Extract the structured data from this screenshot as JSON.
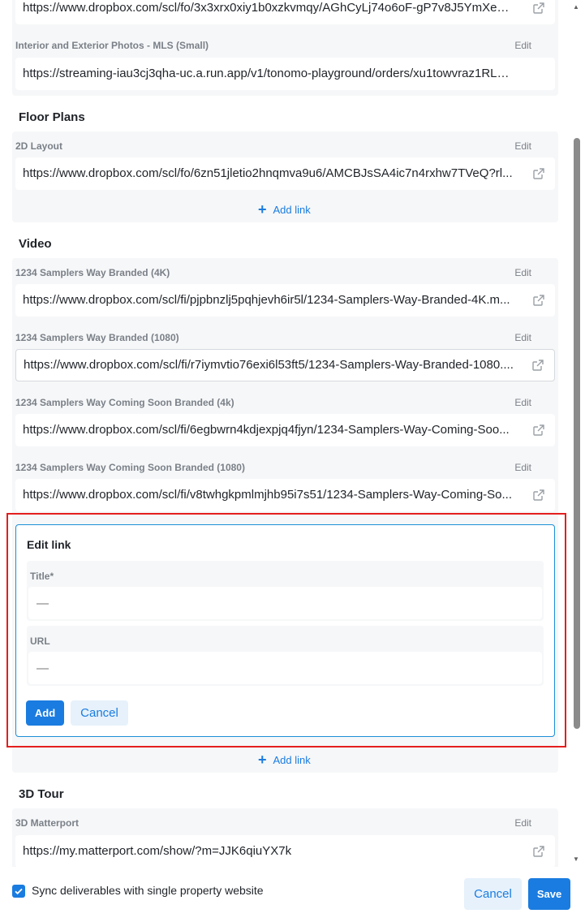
{
  "top_partial": {
    "url": "https://www.dropbox.com/scl/fo/3x3xrx0xiy1b0xzkvmqy/AGhCyLj74o6oF-gP7v8J5YmXey-pl..."
  },
  "sections": {
    "photos": {
      "items": [
        {
          "label": "Interior and Exterior Photos - MLS (Small)",
          "edit": "Edit",
          "url": "https://streaming-iau3cj3qha-uc.a.run.app/v1/tonomo-playground/orders/xu1towvraz1RLN..."
        }
      ]
    },
    "floor_plans": {
      "title": "Floor Plans",
      "items": [
        {
          "label": "2D Layout",
          "edit": "Edit",
          "url": "https://www.dropbox.com/scl/fo/6zn51jletio2hnqmva9u6/AMCBJsSA4ic7n4rxhw7TVeQ?rl..."
        }
      ],
      "add_link": "Add link"
    },
    "video": {
      "title": "Video",
      "items": [
        {
          "label": "1234 Samplers Way Branded (4K)",
          "edit": "Edit",
          "url": "https://www.dropbox.com/scl/fi/pjpbnzlj5pqhjevh6ir5l/1234-Samplers-Way-Branded-4K.m..."
        },
        {
          "label": "1234 Samplers Way Branded (1080)",
          "edit": "Edit",
          "url": "https://www.dropbox.com/scl/fi/r7iymvtio76exi6l53ft5/1234-Samplers-Way-Branded-1080...."
        },
        {
          "label": "1234 Samplers Way Coming Soon Branded (4k)",
          "edit": "Edit",
          "url": "https://www.dropbox.com/scl/fi/6egbwrn4kdjexpjq4fjyn/1234-Samplers-Way-Coming-Soo..."
        },
        {
          "label": "1234 Samplers Way Coming Soon Branded (1080)",
          "edit": "Edit",
          "url": "https://www.dropbox.com/scl/fi/v8twhgkpmlmjhb95i7s51/1234-Samplers-Way-Coming-So..."
        }
      ],
      "add_link": "Add link"
    },
    "tour": {
      "title": "3D Tour",
      "items": [
        {
          "label": "3D Matterport",
          "edit": "Edit",
          "url": "https://my.matterport.com/show/?m=JJK6qiuYX7k"
        }
      ]
    }
  },
  "edit_form": {
    "title": "Edit link",
    "title_label": "Title*",
    "title_placeholder": "—",
    "url_label": "URL",
    "url_placeholder": "—",
    "add_button": "Add",
    "cancel_button": "Cancel"
  },
  "footer": {
    "sync_checked": true,
    "sync_label": "Sync deliverables with single property website",
    "cancel_button": "Cancel",
    "save_button": "Save"
  },
  "colors": {
    "accent": "#1a7ce0",
    "highlight": "#e41e1e",
    "panel": "#f6f7f8"
  }
}
